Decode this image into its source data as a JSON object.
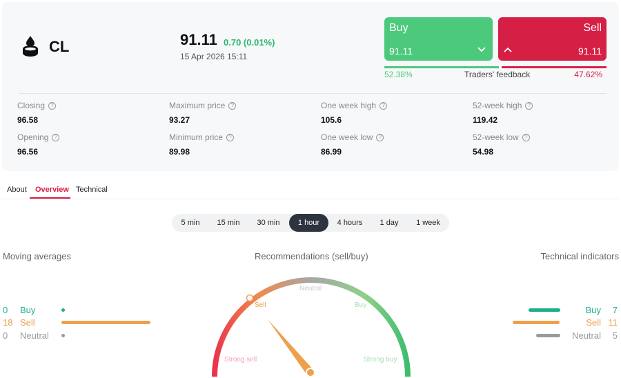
{
  "instrument": {
    "ticker": "CL",
    "icon": "oil-drop-icon",
    "price": "91.11",
    "change": "0.70 (0.01%)",
    "timestamp": "15 Apr 2026 15:11"
  },
  "trade": {
    "buy_label": "Buy",
    "buy_price": "91.11",
    "sell_label": "Sell",
    "sell_price": "91.11",
    "buy_color": "#4cc97b",
    "sell_color": "#d61f45"
  },
  "feedback": {
    "buy_pct": "52.38%",
    "label": "Traders' feedback",
    "sell_pct": "47.62%",
    "buy_fraction": 0.5238
  },
  "stats": [
    {
      "label": "Closing",
      "value": "96.58"
    },
    {
      "label": "Maximum price",
      "value": "93.27"
    },
    {
      "label": "One week high",
      "value": "105.6"
    },
    {
      "label": "52-week high",
      "value": "119.42"
    },
    {
      "label": "Opening",
      "value": "96.56"
    },
    {
      "label": "Minimum price",
      "value": "89.98"
    },
    {
      "label": "One week low",
      "value": "86.99"
    },
    {
      "label": "52-week low",
      "value": "54.98"
    }
  ],
  "tabs": [
    {
      "label": "About"
    },
    {
      "label": "Overview",
      "active": true
    },
    {
      "label": "Technical"
    }
  ],
  "periods": [
    {
      "label": "5 min"
    },
    {
      "label": "15 min"
    },
    {
      "label": "30 min"
    },
    {
      "label": "1 hour",
      "active": true
    },
    {
      "label": "4 hours"
    },
    {
      "label": "1 day"
    },
    {
      "label": "1 week"
    }
  ],
  "moving_averages": {
    "title": "Moving averages",
    "buy": {
      "count": "0",
      "label": "Buy"
    },
    "sell": {
      "count": "18",
      "label": "Sell"
    },
    "neutral": {
      "count": "0",
      "label": "Neutral"
    }
  },
  "recommendations": {
    "title": "Recommendations (sell/buy)",
    "strong_sell": "Strong sell",
    "sell": "Sell",
    "neutral": "Neutral",
    "buy": "Buy",
    "strong_buy": "Strong buy",
    "current": "Sell"
  },
  "technical_indicators": {
    "title": "Technical indicators",
    "buy": {
      "count": "7",
      "label": "Buy"
    },
    "sell": {
      "count": "11",
      "label": "Sell"
    },
    "neutral": {
      "count": "5",
      "label": "Neutral"
    }
  },
  "colors": {
    "buy": "#1fae8b",
    "sell": "#eea04c",
    "neutral": "#9a9a9a",
    "accent": "#d61f45"
  }
}
